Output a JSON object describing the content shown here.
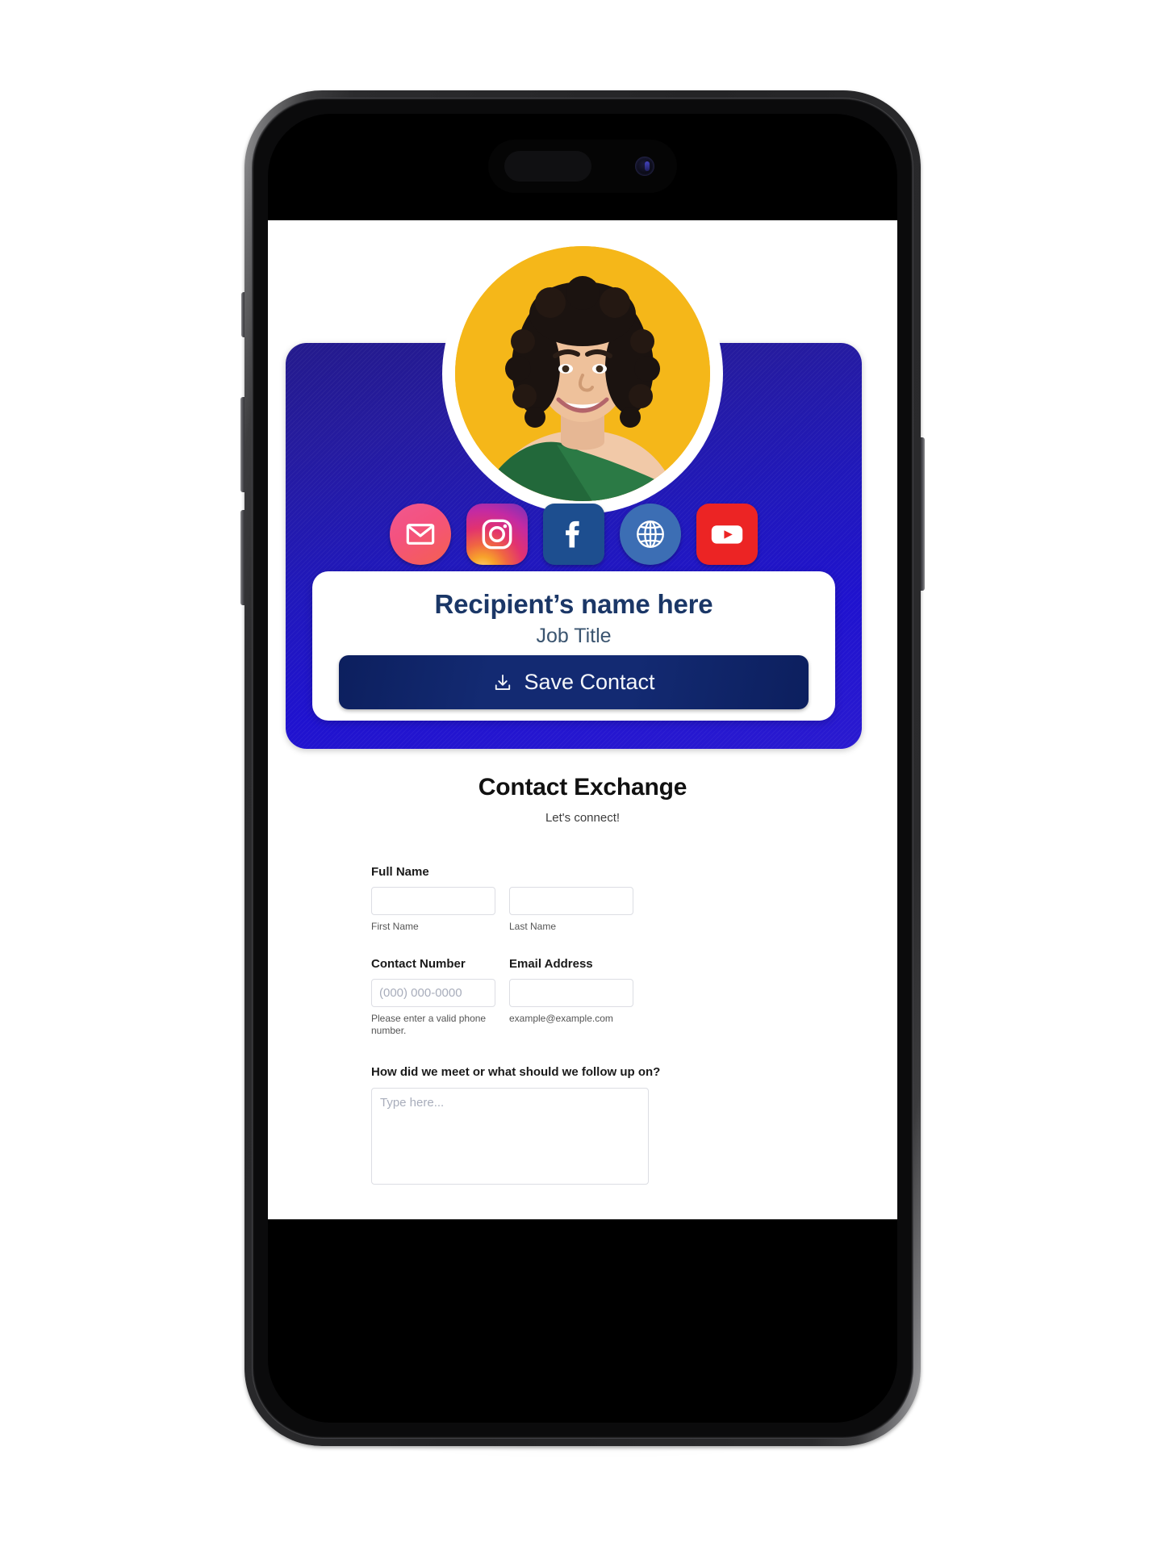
{
  "device": {
    "name": "iphone-mockup",
    "dynamic_island": "dynamic-island",
    "buttons": [
      "action-button",
      "volume-up-button",
      "volume-down-button",
      "power-button"
    ]
  },
  "profile": {
    "avatar_alt": "smiling woman with curly hair on yellow background",
    "avatar_bg": "#F5B719",
    "card_gradient_start": "#241a8c",
    "card_gradient_end": "#2a1ad0",
    "name": "Recipient’s name here",
    "job_title": "Job Title",
    "save_button_label": "Save Contact",
    "save_button_color": "#132a72",
    "name_color": "#1b3767"
  },
  "social_links": [
    {
      "name": "email",
      "label": "Email",
      "icon": "envelope-icon",
      "color": "#f4527f"
    },
    {
      "name": "instagram",
      "label": "Instagram",
      "icon": "instagram-icon",
      "color": "#c32aa3"
    },
    {
      "name": "facebook",
      "label": "Facebook",
      "icon": "facebook-icon",
      "color": "#1d4e8f"
    },
    {
      "name": "website",
      "label": "Website",
      "icon": "globe-icon",
      "color": "#3c6eb4"
    },
    {
      "name": "youtube",
      "label": "YouTube",
      "icon": "youtube-icon",
      "color": "#ec2424"
    }
  ],
  "form": {
    "title": "Contact Exchange",
    "subtitle": "Let's connect!",
    "full_name": {
      "label": "Full Name",
      "first": {
        "value": "",
        "placeholder": "",
        "sublabel": "First Name"
      },
      "last": {
        "value": "",
        "placeholder": "",
        "sublabel": "Last Name"
      }
    },
    "contact_number": {
      "label": "Contact Number",
      "value": "",
      "placeholder": "(000) 000-0000",
      "hint": "Please enter a valid phone number."
    },
    "email_address": {
      "label": "Email Address",
      "value": "",
      "placeholder": "",
      "hint": "example@example.com"
    },
    "followup": {
      "label": "How did we meet or what should we follow up on?",
      "value": "",
      "placeholder": "Type here..."
    }
  }
}
